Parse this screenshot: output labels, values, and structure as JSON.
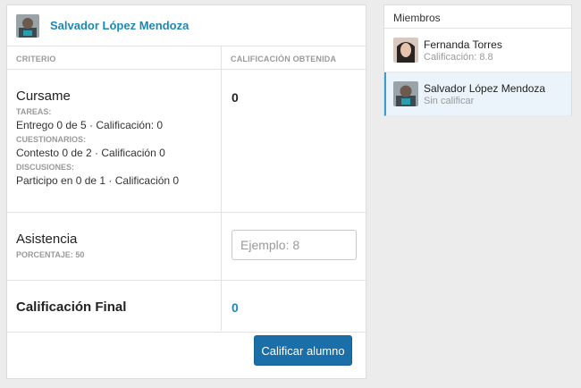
{
  "student": {
    "name": "Salvador López Mendoza"
  },
  "table": {
    "col_criterio": "CRITERIO",
    "col_calificacion": "CALIFICACIÓN OBTENIDA"
  },
  "cursame": {
    "title": "Cursame",
    "score": "0",
    "tareas_label": "TAREAS:",
    "tareas_value": "Entrego 0 de 5 · Calificación: 0",
    "cuestionarios_label": "CUESTIONARIOS:",
    "cuestionarios_value": "Contesto 0 de 2 · Calificación 0",
    "discusiones_label": "DISCUSIONES:",
    "discusiones_value": "Participo en 0 de 1 · Calificación 0"
  },
  "asistencia": {
    "title": "Asistencia",
    "porcentaje": "PORCENTAJE: 50",
    "input_value": "",
    "input_placeholder": "Ejemplo: 8"
  },
  "final": {
    "title": "Calificación Final",
    "score": "0"
  },
  "submit_label": "Calificar alumno",
  "sidebar": {
    "title": "Miembros",
    "members": [
      {
        "name": "Fernanda Torres",
        "status": "Calificación: 8.8"
      },
      {
        "name": "Salvador López Mendoza",
        "status": "Sin calificar"
      }
    ]
  },
  "colors": {
    "accent": "#1e88b5",
    "button": "#1a6fa8",
    "active_border": "#3a9cd0"
  }
}
